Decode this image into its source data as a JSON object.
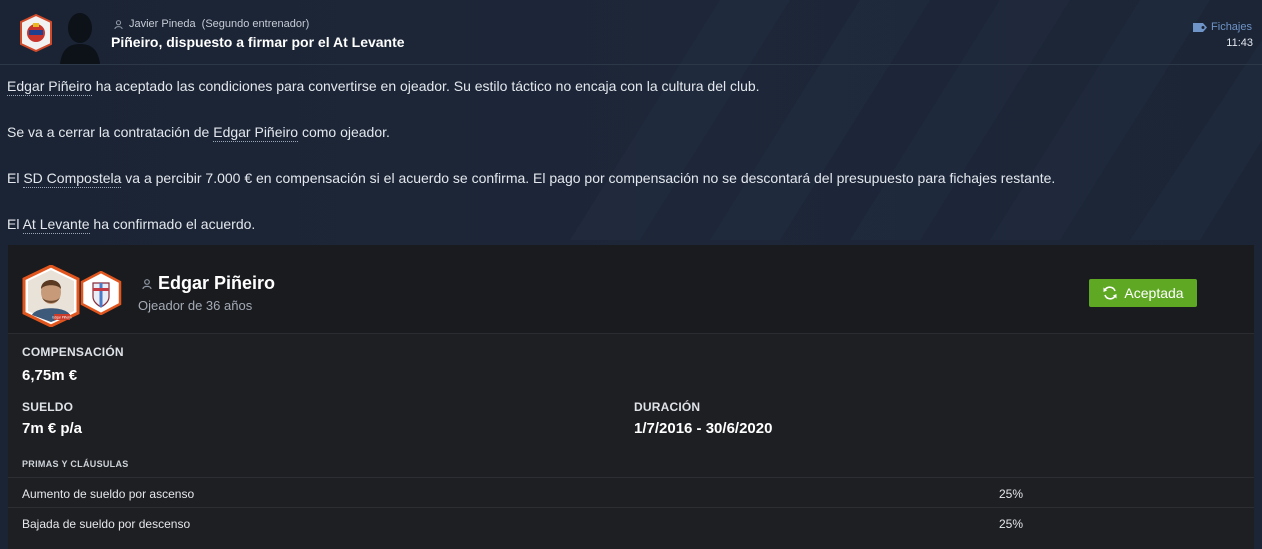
{
  "header": {
    "sender_name": "Javier Pineda",
    "sender_role": "(Segundo entrenador)",
    "subject": "Piñeiro, dispuesto a firmar por el At Levante",
    "category": "Fichajes",
    "time": "11:43",
    "icons": {
      "club_badge": "club-crest-icon",
      "sender_avatar": "person-silhouette-icon",
      "sender_marker": "person-icon",
      "category": "tag-icon"
    }
  },
  "body": {
    "p1": {
      "link": "Edgar Piñeiro",
      "text": " ha aceptado las condiciones para convertirse en ojeador. Su estilo táctico no encaja con la cultura del club."
    },
    "p2": {
      "pre": "Se va a cerrar la contratación de ",
      "link": "Edgar Piñeiro",
      "post": " como ojeador."
    },
    "p3": {
      "pre": "El ",
      "link": "SD Compostela",
      "post": " va a percibir 7.000 € en compensación si el acuerdo se confirma. El pago por compensación no se descontará del presupuesto para fichajes restante."
    },
    "p4": {
      "pre": "El ",
      "link": "At Levante",
      "post": " ha confirmado el acuerdo."
    }
  },
  "card": {
    "player_name": "Edgar Piñeiro",
    "player_sub": "Ojeador de 36 años",
    "photo_tag": "Edgar Piñeiro",
    "status_label": "Aceptada",
    "compensation_label": "COMPENSACIÓN",
    "compensation_value": "6,75m €",
    "salary_label": "SUELDO",
    "salary_value": "7m € p/a",
    "duration_label": "DURACIÓN",
    "duration_value": "1/7/2016 - 30/6/2020",
    "clauses_label": "PRIMAS Y CLÁUSULAS",
    "clauses": [
      {
        "name": "Aumento de sueldo por ascenso",
        "value": "25%"
      },
      {
        "name": "Bajada de sueldo por descenso",
        "value": "25%"
      }
    ]
  },
  "colors": {
    "background": "#1b2434",
    "card": "#1e1f23",
    "accent_green": "#5fa824",
    "category_blue": "#6f94c8"
  }
}
